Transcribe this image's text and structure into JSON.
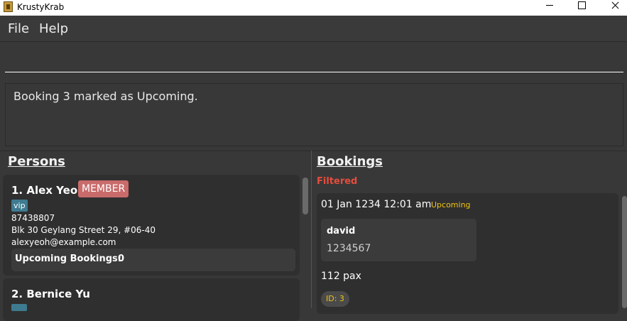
{
  "window": {
    "title": "KrustyKrab"
  },
  "menu": {
    "file": "File",
    "help": "Help"
  },
  "command": {
    "value": ""
  },
  "result": {
    "message": "Booking 3 marked as Upcoming."
  },
  "persons": {
    "title": "Persons",
    "items": [
      {
        "index_name": "1. Alex Yeoh",
        "badge": "MEMBER",
        "tag": "vip",
        "phone": "87438807",
        "address": "Blk 30 Geylang Street 29, #06-40",
        "email": "alexyeoh@example.com",
        "upcoming_label": "Upcoming Bookings:",
        "upcoming_count": "0"
      },
      {
        "index_name": "2. Bernice Yu"
      }
    ]
  },
  "bookings": {
    "title": "Bookings",
    "filter_label": "Filtered",
    "items": [
      {
        "datetime": "01 Jan 1234 12:01 am",
        "status": "Upcoming",
        "customer_name": "david",
        "customer_phone": "1234567",
        "pax": "112 pax",
        "id": "ID: 3"
      }
    ]
  },
  "colors": {
    "background": "#383838",
    "card": "#2f2f2f",
    "member_badge": "#c96b6b",
    "vip_tag": "#3e7b91",
    "status_upcoming": "#f1c40f",
    "filtered": "#e74c3c"
  }
}
